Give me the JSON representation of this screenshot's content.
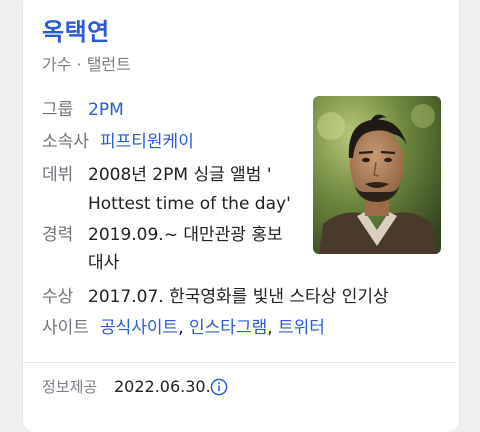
{
  "profile": {
    "name": "옥택연",
    "subtitle": "가수 · 탤런트"
  },
  "rows": {
    "group": {
      "label": "그룹",
      "value": "2PM"
    },
    "agency": {
      "label": "소속사",
      "value": "피프티원케이"
    },
    "debut": {
      "label": "데뷔",
      "line1": "2008년 2PM 싱글 앨범 '",
      "line2": "Hottest time of the day'"
    },
    "career": {
      "label": "경력",
      "line1": "2019.09.~ 대만관광 홍보",
      "line2": "대사"
    },
    "award": {
      "label": "수상",
      "value": "2017.07. 한국영화를 빛낸 스타상 인기상"
    },
    "site": {
      "label": "사이트",
      "links": [
        "공식사이트",
        "인스타그램",
        "트위터"
      ],
      "separator": ", "
    }
  },
  "footer": {
    "label": "정보제공",
    "date": "2022.06.30."
  },
  "colors": {
    "link": "#2a5bd7",
    "label": "#6f737a",
    "text": "#202124"
  }
}
